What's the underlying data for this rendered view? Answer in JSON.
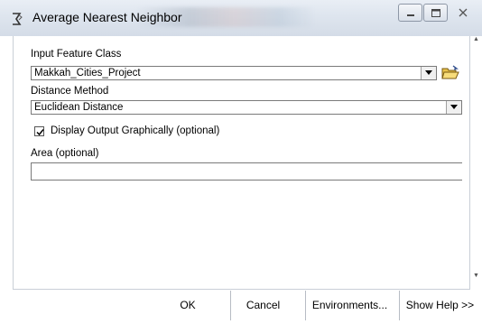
{
  "window": {
    "title": "Average Nearest Neighbor",
    "controls": [
      "minimize",
      "maximize",
      "close"
    ]
  },
  "form": {
    "input_feature_class": {
      "label": "Input Feature Class",
      "value": "Makkah_Cities_Project"
    },
    "distance_method": {
      "label": "Distance Method",
      "value": "Euclidean Distance"
    },
    "display_output": {
      "label": "Display Output Graphically (optional)",
      "checked": true
    },
    "area": {
      "label": "Area (optional)",
      "value": ""
    }
  },
  "buttons": {
    "ok": "OK",
    "cancel": "Cancel",
    "environments": "Environments...",
    "show_help": "Show Help >>"
  },
  "icons": {
    "app": "tool-icon",
    "browse": "open-folder-icon",
    "dropdown": "chevron-down-icon",
    "check": "checkmark-icon"
  }
}
